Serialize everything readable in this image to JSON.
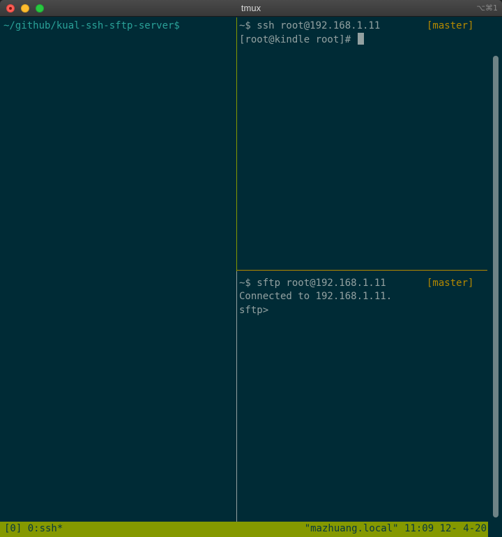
{
  "window": {
    "title": "tmux",
    "shortcut": "⌥⌘1"
  },
  "panes": {
    "left": {
      "prompt": "~/github/kual-ssh-sftp-server$"
    },
    "top_right": {
      "line1_prompt": "~$",
      "line1_command": " ssh root@192.168.1.11",
      "line1_branch": "[master]",
      "line2": "[root@kindle root]# "
    },
    "bottom_right": {
      "line1_prompt": "~$",
      "line1_command": " sftp root@192.168.1.11",
      "line1_branch": "[master]",
      "line2": "Connected to 192.168.1.11.",
      "line3": "sftp>"
    }
  },
  "statusbar": {
    "left": "[0] 0:ssh*",
    "right": "\"mazhuang.local\" 11:09 12- 4-20"
  },
  "colors": {
    "background": "#002b36",
    "foreground": "#93a1a1",
    "accent_cyan": "#2aa198",
    "accent_yellow": "#b58900",
    "status_green": "#859900"
  }
}
